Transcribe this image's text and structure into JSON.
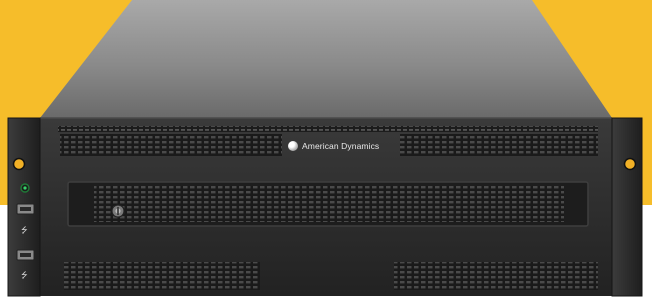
{
  "brand": {
    "logo_text": "American Dynamics"
  },
  "colors": {
    "background_accent": "#f6bd2a",
    "chassis": "#2b2b2b",
    "top_cover": "#8e8e8e"
  },
  "icons": {
    "power_led": "power-led-icon",
    "key_lock": "key-lock-icon",
    "usb_port": "usb-port-icon"
  }
}
